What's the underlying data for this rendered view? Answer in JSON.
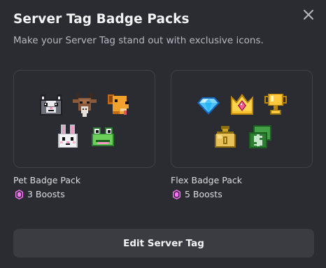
{
  "modal": {
    "title": "Server Tag Badge Packs",
    "subtitle": "Make your Server Tag stand out with exclusive icons."
  },
  "packs": [
    {
      "name": "Pet Badge Pack",
      "boosts": "3 Boosts",
      "badges": [
        "cat-badge-icon",
        "goat-badge-icon",
        "dog-badge-icon",
        "bunny-badge-icon",
        "frog-badge-icon"
      ]
    },
    {
      "name": "Flex Badge Pack",
      "boosts": "5 Boosts",
      "badges": [
        "diamond-badge-icon",
        "crown-badge-icon",
        "trophy-badge-icon",
        "money-bag-badge-icon",
        "cash-badge-icon"
      ]
    }
  ],
  "actions": {
    "edit_label": "Edit Server Tag"
  },
  "colors": {
    "background": "#2b2c31",
    "card_border": "#3f4147",
    "button": "#3b3c42",
    "boost_icon": "#ff73fa",
    "text_primary": "#f2f3f5",
    "text_secondary": "#b5bac1"
  }
}
